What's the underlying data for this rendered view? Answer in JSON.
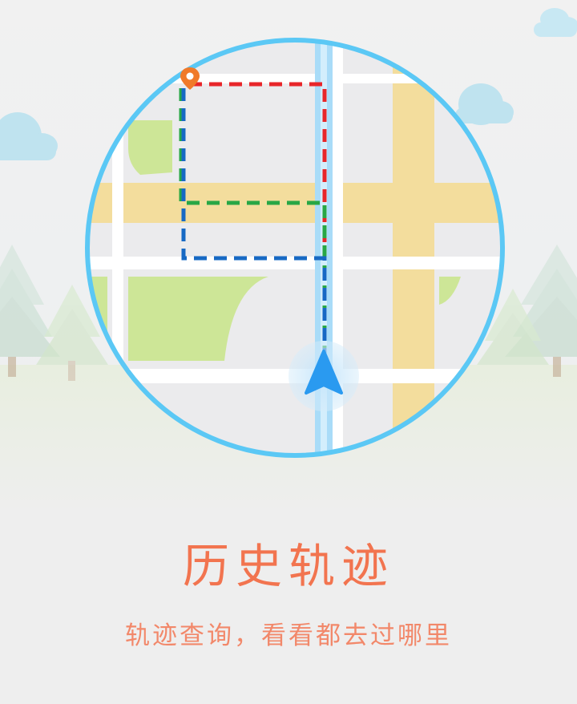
{
  "feature": {
    "title": "历史轨迹",
    "subtitle": "轨迹查询，看看都去过哪里"
  },
  "colors": {
    "title_text": "#f2744f",
    "subtitle_text": "#f2886a",
    "map_border": "#5bc8f5",
    "route_red": "#e8262a",
    "route_green": "#28a745",
    "route_blue": "#1769c4",
    "location_arrow": "#2a9af0",
    "destination_pin": "#f07a2a"
  },
  "illustration": {
    "icons": [
      "cloud-icon",
      "pine-tree-icon",
      "location-pin-icon",
      "navigation-arrow-icon"
    ]
  }
}
